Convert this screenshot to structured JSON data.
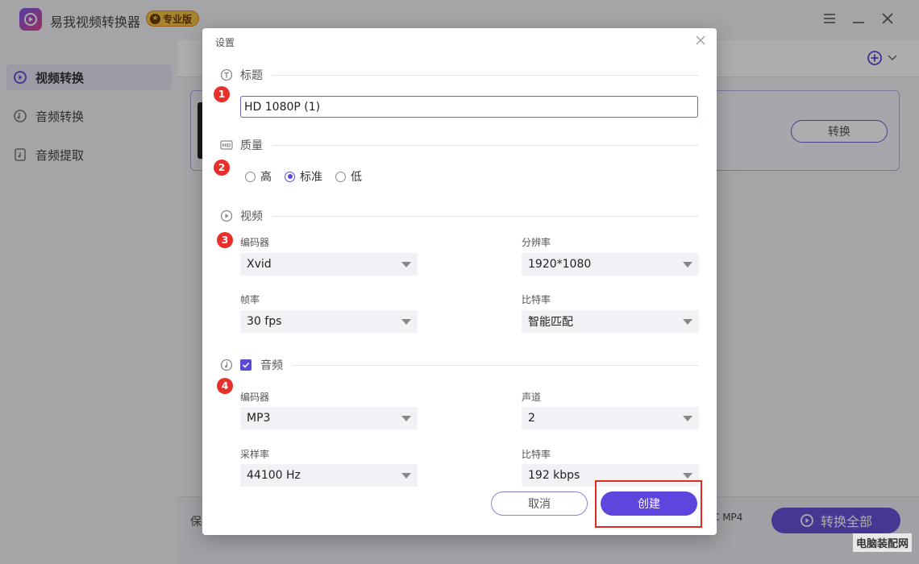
{
  "app": {
    "title": "易我视频转换器",
    "badge": "专业版"
  },
  "sidebar": {
    "items": [
      {
        "label": "视频转换",
        "icon": "video-convert-icon",
        "active": true
      },
      {
        "label": "音频转换",
        "icon": "audio-convert-icon",
        "active": false
      },
      {
        "label": "音频提取",
        "icon": "audio-extract-icon",
        "active": false
      }
    ]
  },
  "main": {
    "convert_label": "转换",
    "save_label": "保",
    "format_tag": "C MP4",
    "convert_all_label": "转换全部"
  },
  "dialog": {
    "title": "设置",
    "sections": {
      "title": "标题",
      "quality": "质量",
      "video": "视频",
      "audio": "音频"
    },
    "title_value": "HD 1080P (1)",
    "quality_options": [
      "高",
      "标准",
      "低"
    ],
    "quality_selected": "标准",
    "video": {
      "encoder_label": "编码器",
      "encoder_value": "Xvid",
      "resolution_label": "分辨率",
      "resolution_value": "1920*1080",
      "framerate_label": "帧率",
      "framerate_value": "30 fps",
      "bitrate_label": "比特率",
      "bitrate_value": "智能匹配"
    },
    "audio": {
      "enabled": true,
      "encoder_label": "编码器",
      "encoder_value": "MP3",
      "channel_label": "声道",
      "channel_value": "2",
      "samplerate_label": "采样率",
      "samplerate_value": "44100 Hz",
      "bitrate_label": "比特率",
      "bitrate_value": "192 kbps"
    },
    "cancel_label": "取消",
    "create_label": "创建"
  },
  "annotations": {
    "badges": [
      "1",
      "2",
      "3",
      "4"
    ],
    "highlight_color": "#e02a24"
  },
  "watermark": "电脑装配网",
  "colors": {
    "accent": "#5d45de",
    "badge_red": "#e8302a"
  }
}
